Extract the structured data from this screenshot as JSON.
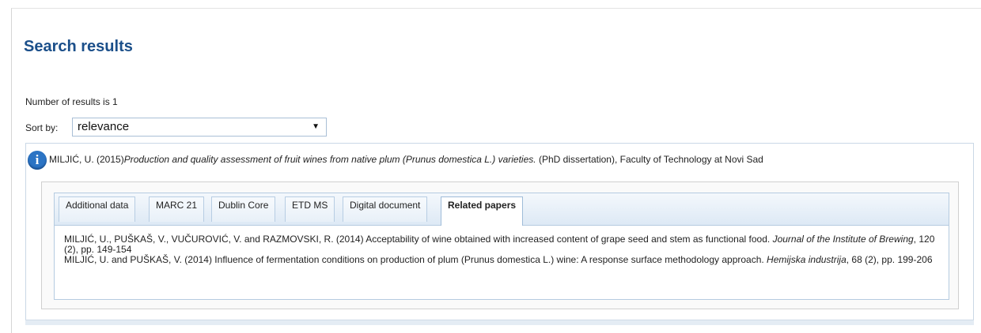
{
  "page": {
    "title": "Search results"
  },
  "results": {
    "count_text": "Number of results is 1"
  },
  "sort": {
    "label": "Sort by:",
    "value": "relevance",
    "caret": "▼"
  },
  "result": {
    "info_icon": "i",
    "citation": {
      "authors_year": "MILJIĆ, U. (2015)",
      "title": "Production and quality assessment of fruit wines from native plum (Prunus domestica L.) varieties.",
      "rest": " (PhD dissertation), Faculty of Technology at Novi Sad"
    }
  },
  "tabs": [
    {
      "label": "Additional data",
      "active": false
    },
    {
      "label": "MARC 21",
      "active": false
    },
    {
      "label": "Dublin Core",
      "active": false
    },
    {
      "label": "ETD MS",
      "active": false
    },
    {
      "label": "Digital document",
      "active": false
    },
    {
      "label": "Related papers",
      "active": true
    }
  ],
  "related_papers": [
    {
      "text": "MILJIĆ, U., PUŠKAŠ, V., VUČUROVIĆ, V. and RAZMOVSKI, R. (2014) Acceptability of wine obtained with increased content of grape seed and stem as functional food. ",
      "journal": "Journal of the Institute of Brewing",
      "details": ", 120 (2), pp. 149-154"
    },
    {
      "text": "MILJIĆ, U. and PUŠKAŠ, V. (2014) Influence of fermentation conditions on production of plum (Prunus domestica L.) wine: A response surface methodology approach. ",
      "journal": "Hemijska industrija",
      "details": ", 68 (2), pp. 199-206"
    }
  ],
  "colors": {
    "title": "#1b4f8a",
    "accent": "#2c74c4",
    "tab_border": "#b7cde3"
  }
}
